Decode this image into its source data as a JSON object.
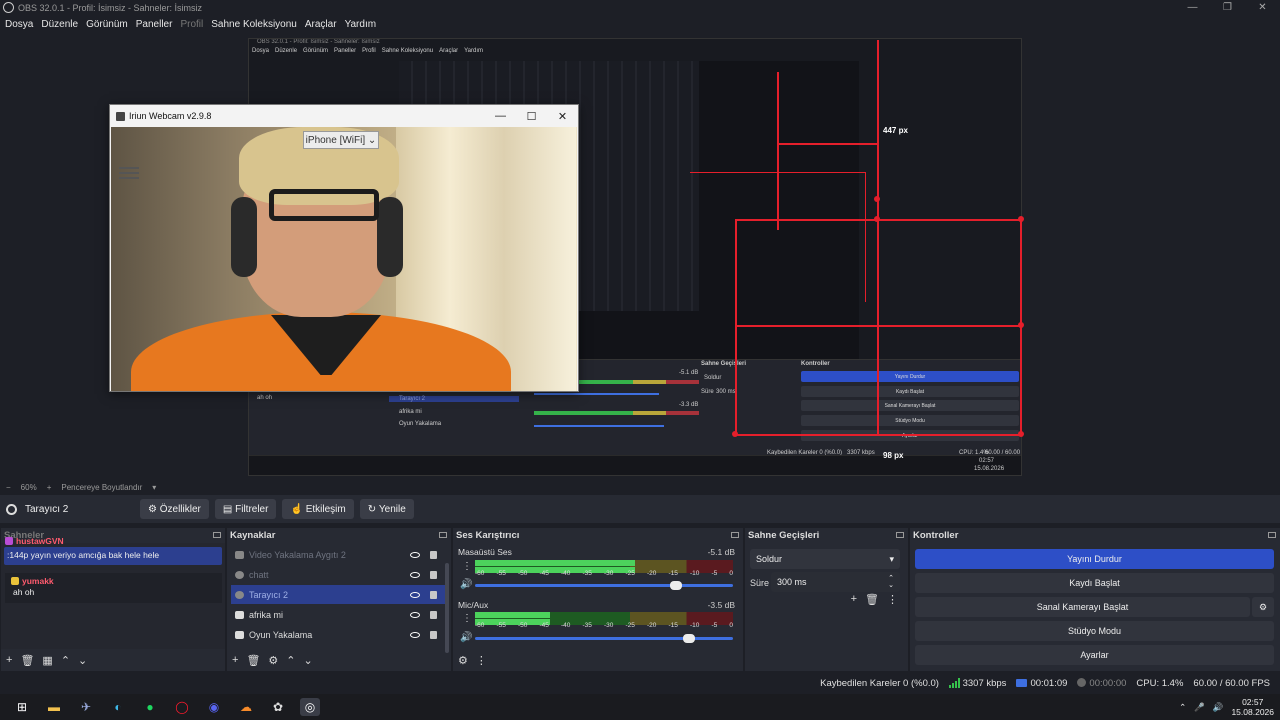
{
  "window": {
    "title": "OBS 32.0.1 - Profil: İsimsiz - Sahneler: İsimsiz"
  },
  "menu": [
    "Dosya",
    "Düzenle",
    "Görünüm",
    "Paneller",
    "Profil",
    "Sahne Koleksiyonu",
    "Araçlar",
    "Yardım"
  ],
  "nested": {
    "title": "OBS 32.0.1 - Profil: İsimsiz - Sahneler: İsimsiz",
    "menu": [
      "Dosya",
      "Düzenle",
      "Görünüm",
      "Paneller",
      "Profil",
      "Sahne Koleksiyonu",
      "Araçlar",
      "Yardım"
    ],
    "sources": [
      "Tarayıcı 2",
      "afrika mi",
      "Oyun Yakalama"
    ],
    "chat": "ah oh",
    "transitions_title": "Sahne Geçişleri",
    "controls_title": "Kontroller",
    "controls": [
      "Yayını Durdur",
      "Kaydı Başlat",
      "Sanal Kamerayı Başlat",
      "Stüdyo Modu",
      "Ayarlar"
    ],
    "transition": "Soldur",
    "duration_label": "Süre",
    "duration": "300 ms",
    "db1": "-5.1 dB",
    "db2": "-3.3 dB",
    "status": "Kaybedilen Kareler 0 (%0.0)",
    "kbps": "3307 kbps",
    "cpu": "CPU: 1.4%",
    "fps": "60.00 / 60.00 FPS",
    "clock_time": "02:57",
    "clock_date": "15.08.2026"
  },
  "annotations": {
    "label_447": "447 px",
    "label_98": "98 px"
  },
  "webcam": {
    "title": "Iriun Webcam v2.9.8",
    "device": "iPhone [WiFi]"
  },
  "zoom": {
    "minus": "−",
    "value": "60%",
    "plus": "+",
    "fit": "Pencereye Boyutlandır"
  },
  "source_toolbar": {
    "name": "Tarayıcı 2",
    "buttons": [
      "Özellikler",
      "Filtreler",
      "Etkileşim",
      "Yenile"
    ]
  },
  "scenes": {
    "title": "Sahneler",
    "messages": [
      {
        "user": "hustawGVN",
        "text": ":144p yayın veriyo amcığa bak hele hele"
      },
      {
        "user": "yumakk",
        "text": "ah oh"
      }
    ]
  },
  "sources": {
    "title": "Kaynaklar",
    "items": [
      {
        "name": "Video Yakalama Aygıtı 2",
        "state": "dim"
      },
      {
        "name": "chatt",
        "state": "dim"
      },
      {
        "name": "Tarayıcı 2",
        "state": "sel"
      },
      {
        "name": "afrika mi",
        "state": ""
      },
      {
        "name": "Oyun Yakalama",
        "state": ""
      }
    ]
  },
  "mixer": {
    "title": "Ses Karıştırıcı",
    "tracks": [
      {
        "name": "Masaüstü Ses",
        "db": "-5.1 dB",
        "level": 0.62,
        "volume": 0.78
      },
      {
        "name": "Mic/Aux",
        "db": "-3.5 dB",
        "level": 0.29,
        "volume": 0.83
      }
    ],
    "ticks": [
      "-60",
      "-55",
      "-50",
      "-45",
      "-40",
      "-35",
      "-30",
      "-25",
      "-20",
      "-15",
      "-10",
      "-5",
      "0"
    ]
  },
  "transitions": {
    "title": "Sahne Geçişleri",
    "selected": "Soldur",
    "duration_label": "Süre",
    "duration": "300 ms"
  },
  "controls": {
    "title": "Kontroller",
    "buttons": [
      "Yayını Durdur",
      "Kaydı Başlat",
      "Sanal Kamerayı Başlat",
      "Stüdyo Modu",
      "Ayarlar"
    ]
  },
  "status": {
    "dropped": "Kaybedilen Kareler 0 (%0.0)",
    "kbps": "3307 kbps",
    "live_time": "00:01:09",
    "rec_time": "00:00:00",
    "cpu": "CPU: 1.4%",
    "fps": "60.00 / 60.00 FPS"
  },
  "taskbar": {
    "time": "02:57",
    "date": "15.08.2026"
  },
  "colors": {
    "accent": "#2d4fc7",
    "annotation_red": "#e51f2b",
    "panel": "#272a33",
    "background": "#1d1f26"
  }
}
